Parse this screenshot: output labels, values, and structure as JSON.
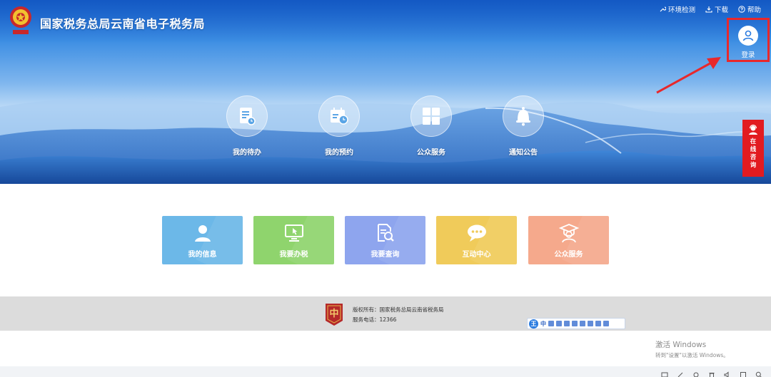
{
  "header": {
    "site_title": "国家税务总局云南省电子税务局",
    "links": [
      {
        "label": "环境检测",
        "icon": "wrench-icon"
      },
      {
        "label": "下载",
        "icon": "download-icon"
      },
      {
        "label": "帮助",
        "icon": "help-icon"
      }
    ],
    "login_label": "登录"
  },
  "quick_nav": [
    {
      "label": "我的待办",
      "icon": "todo-document-icon"
    },
    {
      "label": "我的预约",
      "icon": "calendar-clock-icon"
    },
    {
      "label": "公众服务",
      "icon": "grid-icon"
    },
    {
      "label": "通知公告",
      "icon": "bell-icon"
    }
  ],
  "online_consult": {
    "label": "在线咨询",
    "icon": "headset-user-icon"
  },
  "services": [
    {
      "label": "我的信息",
      "icon": "user-icon",
      "color": "#6cb8e8"
    },
    {
      "label": "我要办税",
      "icon": "monitor-cursor-icon",
      "color": "#8fd46d"
    },
    {
      "label": "我要查询",
      "icon": "document-search-icon",
      "color": "#8ea5ee"
    },
    {
      "label": "互动中心",
      "icon": "chat-bubble-icon",
      "color": "#f0cb5a"
    },
    {
      "label": "公众服务",
      "icon": "graduate-user-icon",
      "color": "#f5a98c"
    }
  ],
  "footer": {
    "copyright": "版权所有：国家税务总局云南省税务局",
    "phone": "服务电话：12366"
  },
  "ime_toolbar": {
    "logo": "王",
    "mode": "中"
  },
  "watermark": {
    "title": "激活 Windows",
    "subtitle": "转到\"设置\"以激活 Windows。"
  },
  "colors": {
    "accent_red": "#e21b20",
    "banner_blue": "#1f6fd6"
  }
}
